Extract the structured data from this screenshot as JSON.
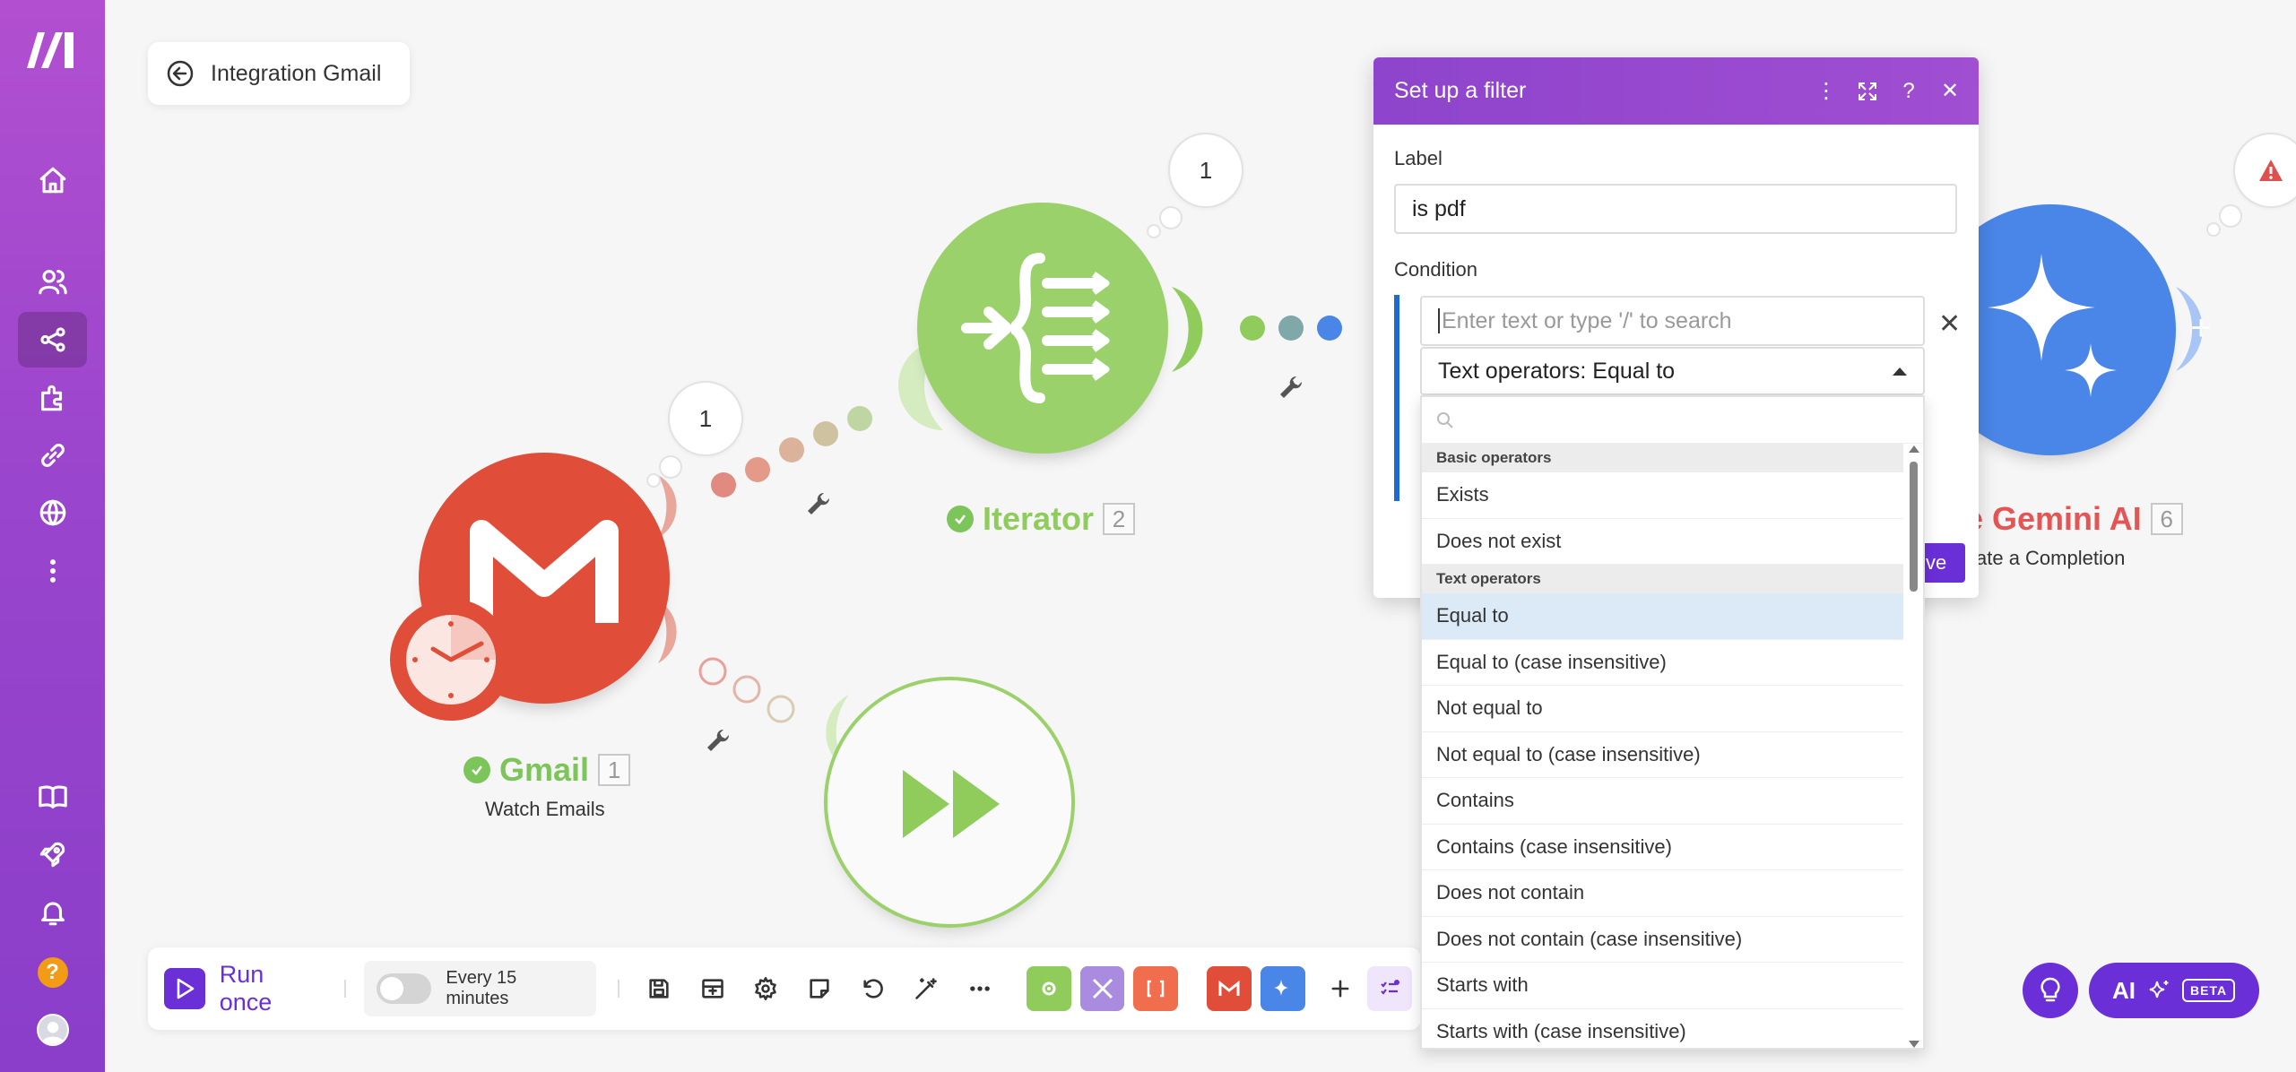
{
  "scenario": {
    "back_label": "Integration Gmail"
  },
  "nodes": {
    "gmail": {
      "title": "Gmail",
      "number": "1",
      "subtitle": "Watch Emails",
      "bubble_count": "1"
    },
    "iterator": {
      "title": "Iterator",
      "number": "2",
      "bubble_count": "1"
    },
    "gemini": {
      "title": "gle Gemini AI",
      "number": "6",
      "subtitle": "ate a Completion"
    }
  },
  "toolbar": {
    "run_once_label": "Run once",
    "schedule_label": "Every 15 minutes",
    "schedule_enabled": false
  },
  "ai_button": {
    "label": "AI",
    "badge": "BETA"
  },
  "filter_panel": {
    "title": "Set up a filter",
    "label_caption": "Label",
    "label_value": "is pdf",
    "condition_caption": "Condition",
    "condition_placeholder": "Enter text or type '/' to search",
    "operator_selected": "Text operators: Equal to",
    "save_label": "ve",
    "groups": {
      "basic": {
        "title": "Basic operators",
        "items": [
          "Exists",
          "Does not exist"
        ]
      },
      "text": {
        "title": "Text operators",
        "items": [
          "Equal to",
          "Equal to (case insensitive)",
          "Not equal to",
          "Not equal to (case insensitive)",
          "Contains",
          "Contains (case insensitive)",
          "Does not contain",
          "Does not contain (case insensitive)",
          "Starts with",
          "Starts with (case insensitive)"
        ]
      }
    },
    "highlighted_item": "Equal to"
  },
  "colors": {
    "brand_purple": "#6b2fd8",
    "gmail_red": "#e04e39",
    "iterator_green": "#9bd16a",
    "gemini_blue": "#4a86e8",
    "filter_blue": "#1d6bd1"
  }
}
